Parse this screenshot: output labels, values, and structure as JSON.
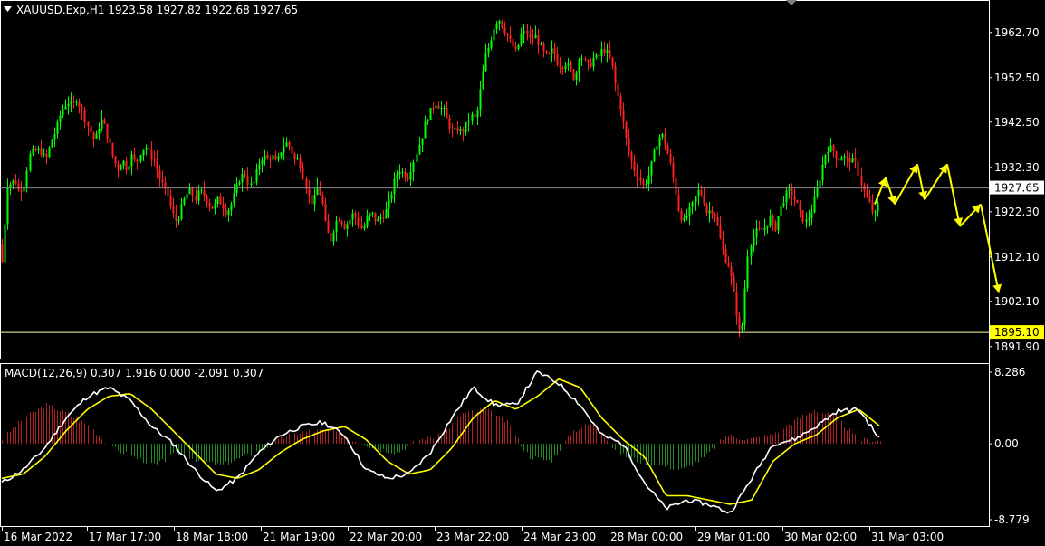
{
  "header": {
    "symbol_line": "XAUUSD.Exp,H1  1923.58 1927.82 1922.68 1927.65",
    "dropdown_icon": "triangle-down-icon"
  },
  "macd": {
    "label": "MACD(12,26,9) 0.307 1.916 0.000 -2.091 0.307",
    "axis_labels": [
      "8.286",
      "0.00",
      "-8.779"
    ]
  },
  "price_axis": {
    "labels": [
      "1962.70",
      "1952.50",
      "1942.50",
      "1932.30",
      "1922.30",
      "1912.10",
      "1902.10",
      "1891.90"
    ],
    "current_price": "1927.65",
    "support_level": "1895.10"
  },
  "time_axis": {
    "labels": [
      "16 Mar 2022",
      "17 Mar 17:00",
      "18 Mar 18:00",
      "21 Mar 19:00",
      "22 Mar 20:00",
      "23 Mar 22:00",
      "24 Mar 23:00",
      "28 Mar 00:00",
      "29 Mar 01:00",
      "30 Mar 02:00",
      "31 Mar 03:00"
    ]
  },
  "colors": {
    "background": "#000000",
    "bull_candle": "#00ff00",
    "bear_candle": "#ff2020",
    "macd_line": "#ffffff",
    "signal_line": "#ffff00",
    "hist_pos": "#b22222",
    "hist_neg": "#228b22",
    "arrow": "#ffff00",
    "grid_line": "#808080"
  },
  "chart_data": [
    {
      "type": "candlestick",
      "title": "XAUUSD.Exp,H1",
      "ohlc_last": {
        "open": 1923.58,
        "high": 1927.82,
        "low": 1922.68,
        "close": 1927.65
      },
      "ylim": [
        1889.0,
        1970.0
      ],
      "close_path": [
        [
          0,
          1915
        ],
        [
          3,
          1909
        ],
        [
          6,
          1925
        ],
        [
          9,
          1930
        ],
        [
          12,
          1928
        ],
        [
          16,
          1930
        ],
        [
          20,
          1927
        ],
        [
          26,
          1928
        ],
        [
          32,
          1935
        ],
        [
          38,
          1936
        ],
        [
          44,
          1936
        ],
        [
          50,
          1934
        ],
        [
          56,
          1938
        ],
        [
          62,
          1941
        ],
        [
          66,
          1944
        ],
        [
          70,
          1946
        ],
        [
          75,
          1947
        ],
        [
          80,
          1946
        ],
        [
          85,
          1948
        ],
        [
          88,
          1946
        ],
        [
          92,
          1944
        ],
        [
          96,
          1942
        ],
        [
          100,
          1940
        ],
        [
          104,
          1938
        ],
        [
          108,
          1941
        ],
        [
          112,
          1943
        ],
        [
          116,
          1941
        ],
        [
          120,
          1938
        ],
        [
          125,
          1934
        ],
        [
          130,
          1932
        ],
        [
          135,
          1934
        ],
        [
          140,
          1932
        ],
        [
          145,
          1935
        ],
        [
          150,
          1933
        ],
        [
          155,
          1936
        ],
        [
          160,
          1937
        ],
        [
          165,
          1935
        ],
        [
          170,
          1934
        ],
        [
          175,
          1930
        ],
        [
          180,
          1928
        ],
        [
          185,
          1926
        ],
        [
          190,
          1922
        ],
        [
          195,
          1920
        ],
        [
          200,
          1923
        ],
        [
          205,
          1926
        ],
        [
          210,
          1927
        ],
        [
          215,
          1925
        ],
        [
          220,
          1927
        ],
        [
          225,
          1926
        ],
        [
          230,
          1924
        ],
        [
          235,
          1923
        ],
        [
          240,
          1925
        ],
        [
          245,
          1924
        ],
        [
          250,
          1922
        ],
        [
          255,
          1924
        ],
        [
          260,
          1927
        ],
        [
          265,
          1930
        ],
        [
          270,
          1931
        ],
        [
          275,
          1928
        ],
        [
          280,
          1929
        ],
        [
          285,
          1933
        ],
        [
          290,
          1935
        ],
        [
          295,
          1934
        ],
        [
          300,
          1935
        ],
        [
          305,
          1933
        ],
        [
          310,
          1936
        ],
        [
          315,
          1938
        ],
        [
          320,
          1937
        ],
        [
          325,
          1934
        ],
        [
          330,
          1934
        ],
        [
          335,
          1930
        ],
        [
          340,
          1926
        ],
        [
          345,
          1924
        ],
        [
          350,
          1928
        ],
        [
          355,
          1925
        ],
        [
          360,
          1918
        ],
        [
          365,
          1916
        ],
        [
          370,
          1920
        ],
        [
          375,
          1921
        ],
        [
          380,
          1919
        ],
        [
          385,
          1920
        ],
        [
          390,
          1922
        ],
        [
          395,
          1920
        ],
        [
          400,
          1918
        ],
        [
          405,
          1921
        ],
        [
          410,
          1922
        ],
        [
          415,
          1920
        ],
        [
          420,
          1921
        ],
        [
          425,
          1922
        ],
        [
          430,
          1925
        ],
        [
          435,
          1929
        ],
        [
          440,
          1932
        ],
        [
          445,
          1931
        ],
        [
          450,
          1930
        ],
        [
          455,
          1933
        ],
        [
          460,
          1936
        ],
        [
          465,
          1939
        ],
        [
          470,
          1943
        ],
        [
          475,
          1945
        ],
        [
          480,
          1947
        ],
        [
          485,
          1946
        ],
        [
          490,
          1945
        ],
        [
          495,
          1942
        ],
        [
          500,
          1940
        ],
        [
          505,
          1941
        ],
        [
          510,
          1940
        ],
        [
          515,
          1942
        ],
        [
          520,
          1944
        ],
        [
          525,
          1943
        ],
        [
          530,
          1950
        ],
        [
          535,
          1957
        ],
        [
          540,
          1960
        ],
        [
          545,
          1964
        ],
        [
          550,
          1966
        ],
        [
          555,
          1964
        ],
        [
          560,
          1962
        ],
        [
          565,
          1960
        ],
        [
          570,
          1958
        ],
        [
          575,
          1962
        ],
        [
          580,
          1963
        ],
        [
          585,
          1961
        ],
        [
          590,
          1962
        ],
        [
          595,
          1960
        ],
        [
          600,
          1958
        ],
        [
          605,
          1957
        ],
        [
          610,
          1959
        ],
        [
          615,
          1956
        ],
        [
          620,
          1955
        ],
        [
          625,
          1956
        ],
        [
          630,
          1954
        ],
        [
          635,
          1952
        ],
        [
          640,
          1958
        ],
        [
          645,
          1956
        ],
        [
          650,
          1955
        ],
        [
          655,
          1957
        ],
        [
          660,
          1957
        ],
        [
          665,
          1959
        ],
        [
          670,
          1958
        ],
        [
          675,
          1956
        ],
        [
          680,
          1950
        ],
        [
          685,
          1946
        ],
        [
          690,
          1940
        ],
        [
          695,
          1935
        ],
        [
          700,
          1932
        ],
        [
          705,
          1930
        ],
        [
          710,
          1928
        ],
        [
          715,
          1930
        ],
        [
          720,
          1934
        ],
        [
          725,
          1938
        ],
        [
          730,
          1940
        ],
        [
          735,
          1937
        ],
        [
          740,
          1933
        ],
        [
          745,
          1928
        ],
        [
          750,
          1922
        ],
        [
          755,
          1920
        ],
        [
          760,
          1922
        ],
        [
          765,
          1924
        ],
        [
          770,
          1927
        ],
        [
          775,
          1926
        ],
        [
          780,
          1922
        ],
        [
          785,
          1923
        ],
        [
          790,
          1921
        ],
        [
          795,
          1916
        ],
        [
          800,
          1912
        ],
        [
          805,
          1910
        ],
        [
          810,
          1904
        ],
        [
          815,
          1897
        ],
        [
          818,
          1893
        ],
        [
          822,
          1904
        ],
        [
          826,
          1914
        ],
        [
          830,
          1916
        ],
        [
          835,
          1918
        ],
        [
          840,
          1918
        ],
        [
          845,
          1919
        ],
        [
          850,
          1921
        ],
        [
          855,
          1918
        ],
        [
          860,
          1922
        ],
        [
          865,
          1925
        ],
        [
          870,
          1927
        ],
        [
          875,
          1926
        ],
        [
          880,
          1924
        ],
        [
          885,
          1921
        ],
        [
          890,
          1920
        ],
        [
          895,
          1922
        ],
        [
          900,
          1926
        ],
        [
          905,
          1930
        ],
        [
          910,
          1935
        ],
        [
          915,
          1937
        ],
        [
          920,
          1936
        ],
        [
          925,
          1934
        ],
        [
          930,
          1935
        ],
        [
          935,
          1934
        ],
        [
          940,
          1934
        ],
        [
          945,
          1933
        ],
        [
          950,
          1929
        ],
        [
          955,
          1926
        ],
        [
          960,
          1924
        ],
        [
          965,
          1921
        ],
        [
          970,
          1925
        ]
      ],
      "forecast_arrow_path": [
        [
          966,
          1924
        ],
        [
          978,
          1930
        ],
        [
          988,
          1924
        ],
        [
          1013,
          1933
        ],
        [
          1021,
          1925
        ],
        [
          1046,
          1933
        ],
        [
          1060,
          1919
        ],
        [
          1083,
          1924
        ],
        [
          1103,
          1904
        ]
      ]
    },
    {
      "type": "line",
      "title": "MACD(12,26,9)",
      "ylim": [
        -8.779,
        8.286
      ],
      "series": [
        {
          "name": "MACD",
          "values": [
            -4.5,
            -3.0,
            -0.5,
            3.0,
            5.5,
            6.5,
            5.0,
            2.0,
            0.0,
            -3.0,
            -5.5,
            -4.0,
            -1.0,
            1.0,
            2.0,
            2.5,
            1.0,
            -3.0,
            -4.0,
            -3.5,
            -1.0,
            3.0,
            6.5,
            4.5,
            4.5,
            8.3,
            7.0,
            4.5,
            1.0,
            0.0,
            -4.5,
            -7.5,
            -6.5,
            -7.0,
            -8.0,
            -4.0,
            0.0,
            0.5,
            2.0,
            3.8,
            4.0,
            0.5
          ]
        },
        {
          "name": "Signal",
          "values": [
            -4.0,
            -3.5,
            -1.5,
            1.5,
            4.0,
            5.5,
            5.8,
            4.0,
            1.5,
            -1.0,
            -3.5,
            -4.0,
            -3.0,
            -1.0,
            0.5,
            1.5,
            2.0,
            0.5,
            -2.0,
            -3.5,
            -3.0,
            -0.5,
            3.0,
            5.0,
            4.0,
            5.5,
            7.5,
            6.5,
            3.0,
            0.5,
            -1.5,
            -6.0,
            -6.0,
            -6.5,
            -7.0,
            -6.5,
            -2.0,
            0.0,
            1.0,
            3.0,
            4.0,
            2.0
          ]
        },
        {
          "name": "Histogram",
          "values": [
            0.5,
            3.0,
            4.5,
            3.5,
            2.0,
            -0.5,
            -1.5,
            -2.5,
            -1.0,
            -2.0,
            -2.5,
            -1.5,
            -0.5,
            1.0,
            1.5,
            1.5,
            0.5,
            -0.5,
            -1.0,
            0.5,
            1.0,
            3.5,
            4.0,
            2.5,
            -1.5,
            -2.0,
            1.5,
            2.5,
            -1.0,
            -2.0,
            -2.5,
            -3.0,
            -1.5,
            1.0,
            0.5,
            1.0,
            2.5,
            4.0,
            3.0,
            0.5,
            0.3
          ]
        }
      ]
    }
  ]
}
